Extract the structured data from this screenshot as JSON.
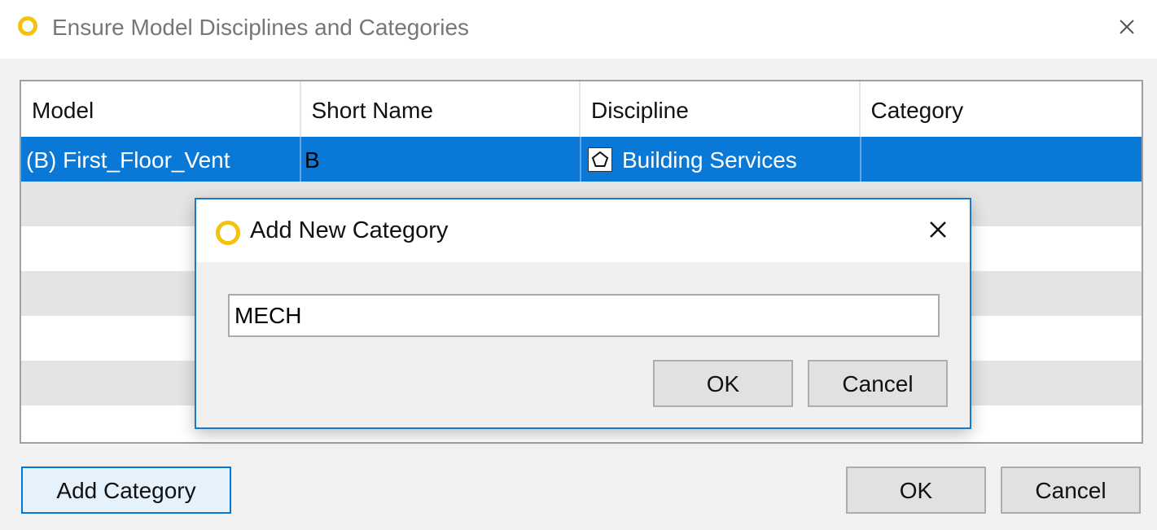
{
  "window": {
    "title": "Ensure Model Disciplines and Categories",
    "logo_color": "#f4c20d"
  },
  "grid": {
    "columns": [
      "Model",
      "Short Name",
      "Discipline",
      "Category"
    ],
    "rows": [
      {
        "model": "(B) First_Floor_Vent",
        "short_name": "B",
        "discipline": "Building Services",
        "discipline_icon": "pentagon-icon",
        "category": "",
        "selected": true
      }
    ],
    "selection_color": "#0a78d7",
    "alt_row_color": "#e4e4e4"
  },
  "footer": {
    "add_category_label": "Add Category",
    "ok_label": "OK",
    "cancel_label": "Cancel"
  },
  "modal": {
    "title": "Add New Category",
    "input_value": "MECH",
    "ok_label": "OK",
    "cancel_label": "Cancel",
    "border_color": "#1c79c7"
  }
}
